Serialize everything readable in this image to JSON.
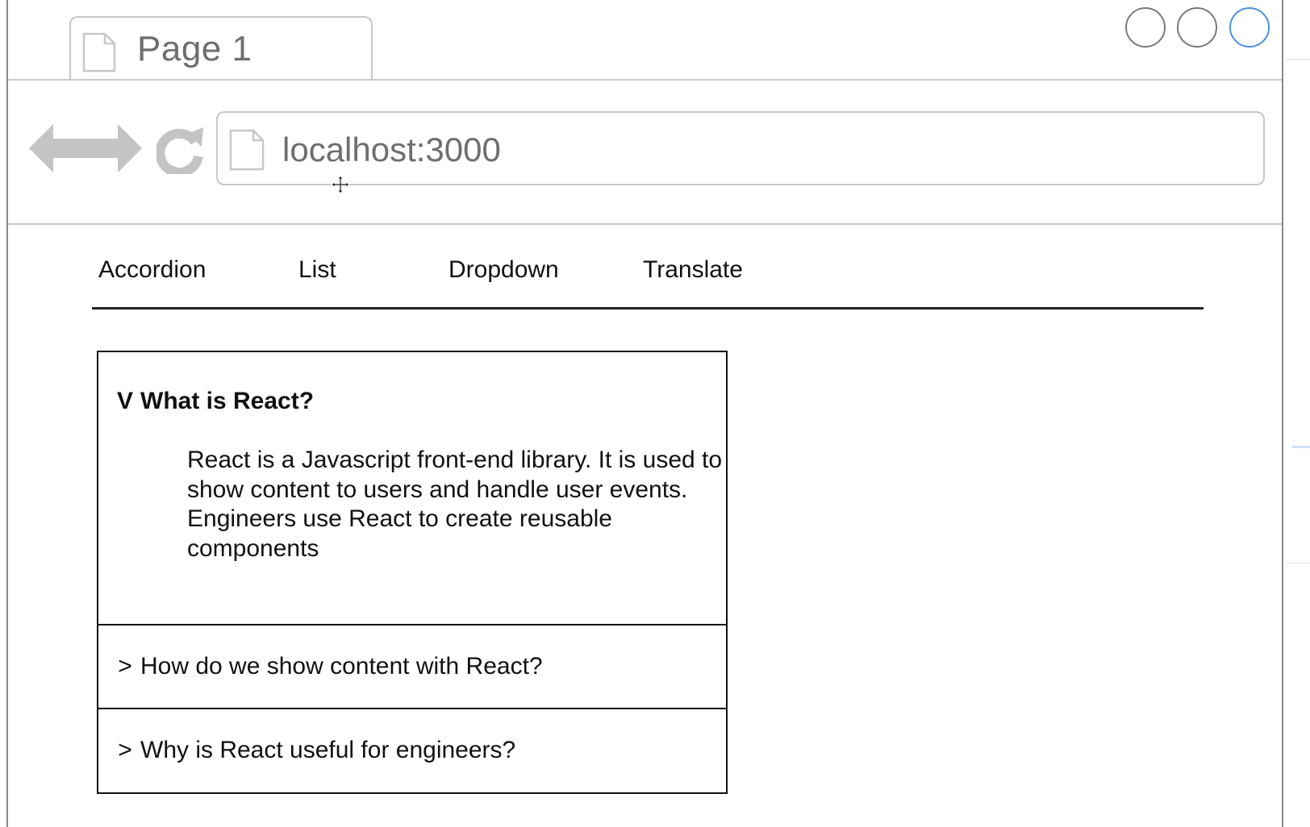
{
  "browser": {
    "tab_title": "Page 1",
    "address": "localhost:3000",
    "colors": {
      "chrome_gray": "#c8c8c8",
      "text_gray": "#6e6e6e",
      "active_blue": "#4a90e2"
    },
    "icons": [
      "page-icon",
      "back-arrow-icon",
      "forward-arrow-icon",
      "reload-icon",
      "move-cursor-icon"
    ]
  },
  "menu": {
    "items": [
      "Accordion",
      "List",
      "Dropdown",
      "Translate"
    ]
  },
  "accordion": {
    "items": [
      {
        "caret": "V",
        "title": "What is React?",
        "content": [
          "React is a Javascript front-end library. It is used to show content to users and handle user events.",
          "Engineers use React to create reusable components"
        ]
      },
      {
        "caret": ">",
        "title": "How do we show content with React?"
      },
      {
        "caret": ">",
        "title": "Why is React useful for engineers?"
      }
    ]
  }
}
